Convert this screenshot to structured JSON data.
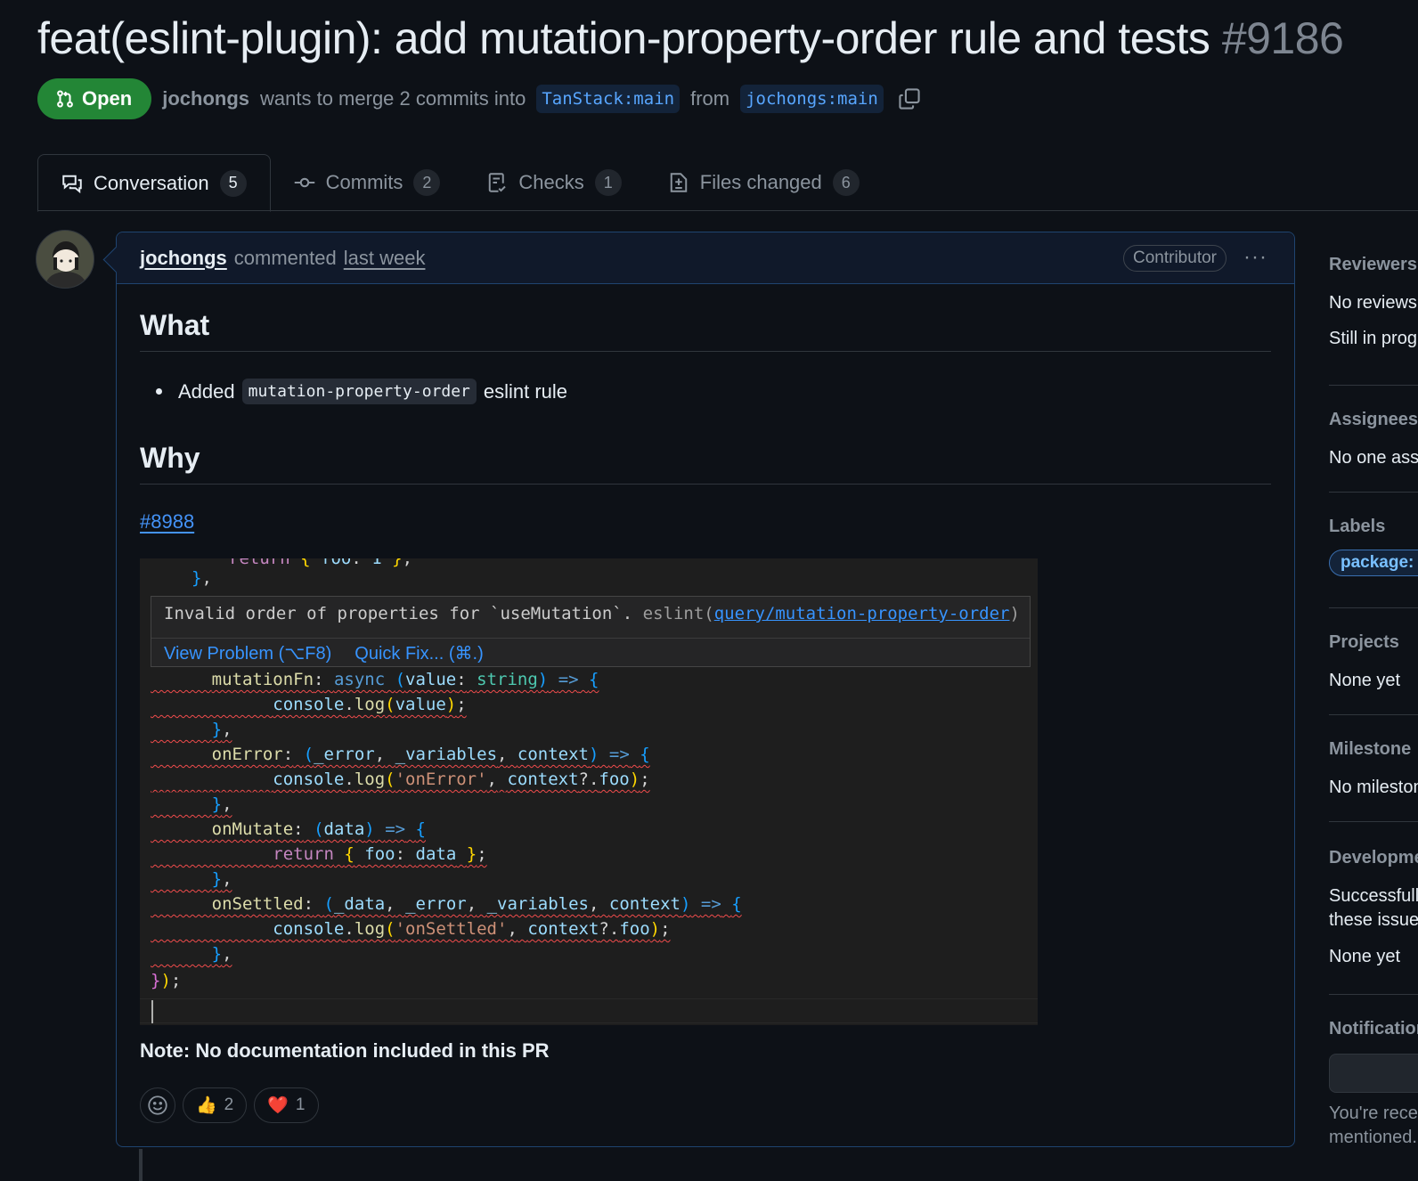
{
  "pr": {
    "title": "feat(eslint-plugin): add mutation-property-order rule and tests",
    "number": "#9186",
    "state": "Open",
    "author": "jochongs",
    "merge_text": "wants to merge 2 commits into",
    "base_branch": "TanStack:main",
    "from_text": "from",
    "head_branch": "jochongs:main"
  },
  "tabs": [
    {
      "label": "Conversation",
      "count": "5",
      "icon": "comment-discussion-icon"
    },
    {
      "label": "Commits",
      "count": "2",
      "icon": "git-commit-icon"
    },
    {
      "label": "Checks",
      "count": "1",
      "icon": "checklist-icon"
    },
    {
      "label": "Files changed",
      "count": "6",
      "icon": "file-diff-icon"
    }
  ],
  "comment": {
    "author": "jochongs",
    "action": "commented",
    "time": "last week",
    "badge": "Contributor",
    "more": "···",
    "heading_what": "What",
    "bullet_prefix": "Added",
    "bullet_code": "mutation-property-order",
    "bullet_suffix": "eslint rule",
    "heading_why": "Why",
    "issue_link": "#8988",
    "note": "Note: No documentation included in this PR",
    "reactions": [
      {
        "emoji": "👍",
        "count": "2"
      },
      {
        "emoji": "❤️",
        "count": "1"
      }
    ]
  },
  "editor": {
    "hover_message": "Invalid order of properties for `useMutation`.",
    "hover_source": "eslint(",
    "hover_rule": "query/mutation-property-order",
    "hover_close": ")",
    "action_view": "View Problem (⌥F8)",
    "action_fix": "Quick Fix... (⌘.)"
  },
  "sidebar": {
    "reviewers": {
      "heading": "Reviewers",
      "line1": "No reviews",
      "line2": "Still in progress"
    },
    "assignees": {
      "heading": "Assignees",
      "line1": "No one assigned"
    },
    "labels": {
      "heading": "Labels",
      "label": "package: eslint-plugin-query"
    },
    "projects": {
      "heading": "Projects",
      "line1": "None yet"
    },
    "milestone": {
      "heading": "Milestone",
      "line1": "No milestone"
    },
    "development": {
      "heading": "Development",
      "line1": "Successfully merging this pull request may close",
      "line2": "these issues.",
      "line3": "None yet"
    },
    "notifications": {
      "heading": "Notifications",
      "line1": "You're receiving notifications because you were",
      "line2": "mentioned."
    }
  },
  "colors": {
    "open_green": "#238636",
    "link_blue": "#4493f8",
    "squiggle_red": "#f14c4c"
  }
}
